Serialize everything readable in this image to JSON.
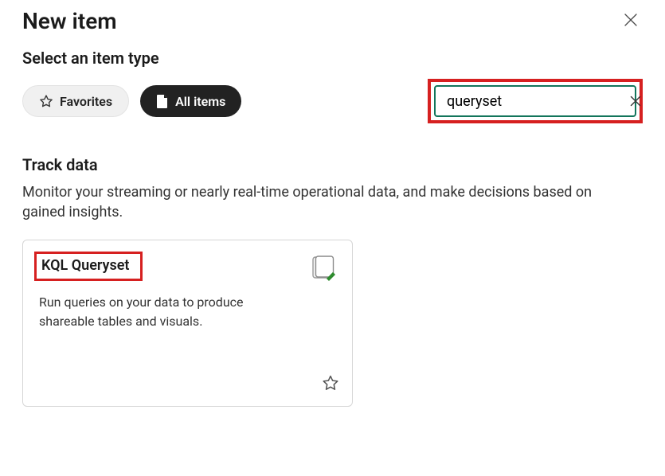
{
  "header": {
    "title": "New item"
  },
  "subtitle": "Select an item type",
  "filters": {
    "favorites_label": "Favorites",
    "all_items_label": "All items"
  },
  "search": {
    "value": "queryset",
    "placeholder": ""
  },
  "section": {
    "title": "Track data",
    "description": "Monitor your streaming or nearly real-time operational data, and make decisions based on gained insights."
  },
  "card": {
    "title": "KQL Queryset",
    "description": "Run queries on your data to produce shareable tables and visuals."
  }
}
